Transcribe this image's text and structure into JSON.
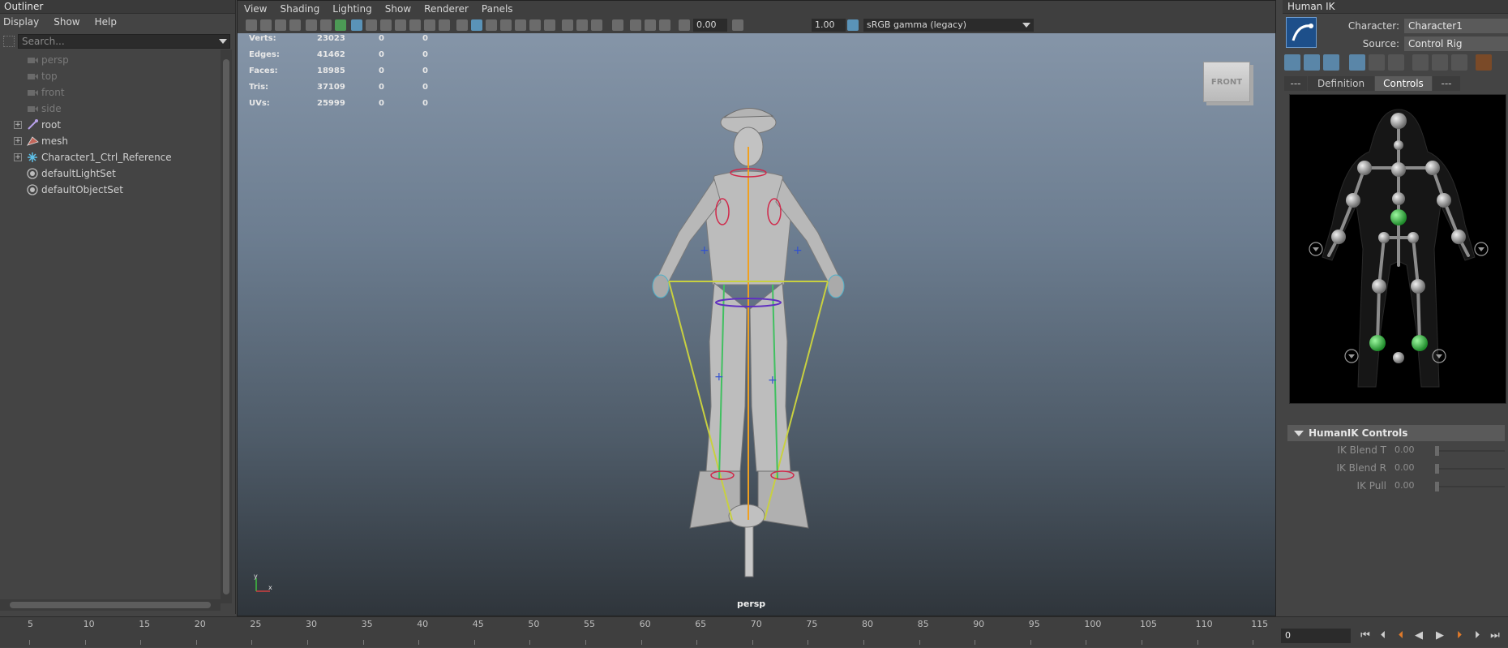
{
  "outliner": {
    "title": "Outliner",
    "menu": [
      "Display",
      "Show",
      "Help"
    ],
    "search_placeholder": "Search...",
    "items": [
      {
        "label": "persp",
        "icon": "camera-icon",
        "dim": true,
        "expandable": false
      },
      {
        "label": "top",
        "icon": "camera-icon",
        "dim": true,
        "expandable": false
      },
      {
        "label": "front",
        "icon": "camera-icon",
        "dim": true,
        "expandable": false
      },
      {
        "label": "side",
        "icon": "camera-icon",
        "dim": true,
        "expandable": false
      },
      {
        "label": "root",
        "icon": "joint-icon",
        "dim": false,
        "expandable": true
      },
      {
        "label": "mesh",
        "icon": "mesh-icon",
        "dim": false,
        "expandable": true
      },
      {
        "label": "Character1_Ctrl_Reference",
        "icon": "hik-reference-icon",
        "dim": false,
        "expandable": true
      },
      {
        "label": "defaultLightSet",
        "icon": "set-icon",
        "dim": false,
        "expandable": false
      },
      {
        "label": "defaultObjectSet",
        "icon": "set-icon",
        "dim": false,
        "expandable": false
      }
    ]
  },
  "viewport": {
    "menu": [
      "View",
      "Shading",
      "Lighting",
      "Show",
      "Renderer",
      "Panels"
    ],
    "exposure": "0.00",
    "gamma": "1.00",
    "color_space": "sRGB gamma (legacy)",
    "camera": "persp",
    "viewcube_label": "FRONT",
    "hud": [
      {
        "label": "Verts:",
        "v1": "23023",
        "v2": "0",
        "v3": "0"
      },
      {
        "label": "Edges:",
        "v1": "41462",
        "v2": "0",
        "v3": "0"
      },
      {
        "label": "Faces:",
        "v1": "18985",
        "v2": "0",
        "v3": "0"
      },
      {
        "label": "Tris:",
        "v1": "37109",
        "v2": "0",
        "v3": "0"
      },
      {
        "label": "UVs:",
        "v1": "25999",
        "v2": "0",
        "v3": "0"
      }
    ],
    "axis": {
      "y": "y",
      "x": "x"
    }
  },
  "humanik": {
    "title": "Human IK",
    "character_label": "Character:",
    "character_value": "Character1",
    "source_label": "Source:",
    "source_value": "Control Rig",
    "tabs": [
      {
        "label": "---",
        "active": false
      },
      {
        "label": "Definition",
        "active": false
      },
      {
        "label": "Controls",
        "active": true
      },
      {
        "label": "---",
        "active": false
      }
    ],
    "section": "HumanIK Controls",
    "ik_rows": [
      {
        "label": "IK Blend T",
        "value": "0.00"
      },
      {
        "label": "IK Blend R",
        "value": "0.00"
      },
      {
        "label": "IK Pull",
        "value": "0.00"
      }
    ],
    "accent_green": "#3bd14a",
    "accent_orange": "#e07a2a"
  },
  "timeline": {
    "ticks": [
      "5",
      "10",
      "15",
      "20",
      "25",
      "30",
      "35",
      "40",
      "45",
      "50",
      "55",
      "60",
      "65",
      "70",
      "75",
      "80",
      "85",
      "90",
      "95",
      "100",
      "105",
      "110",
      "115"
    ],
    "current_frame": "0"
  }
}
